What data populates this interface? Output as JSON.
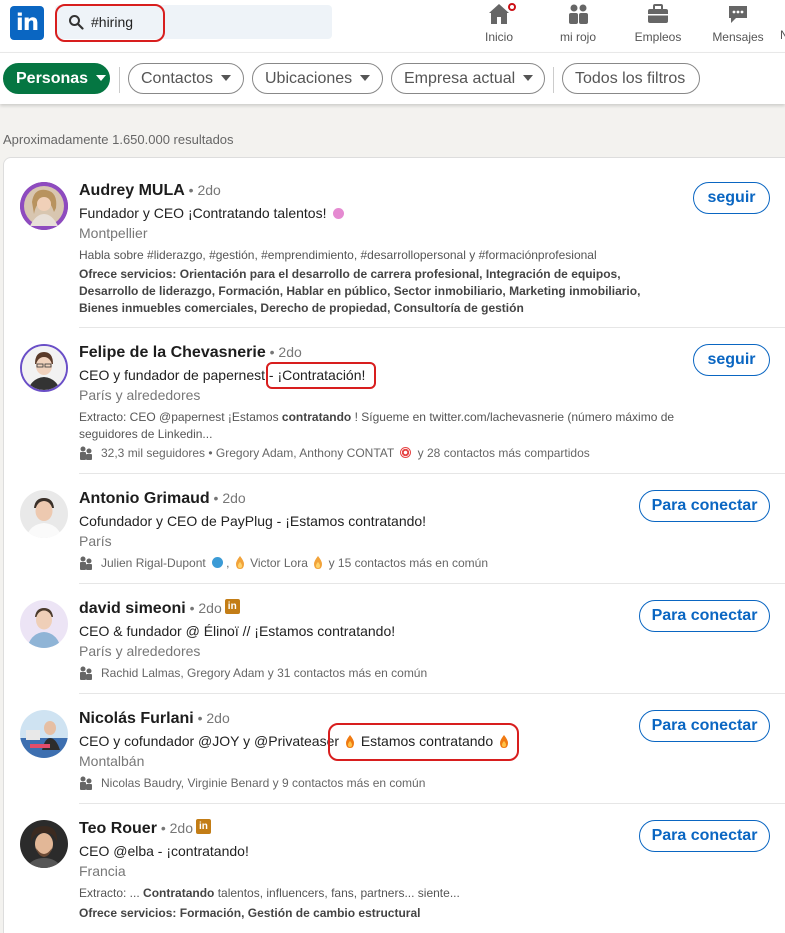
{
  "nav": {
    "logo_text": "in",
    "search_value": "#hiring",
    "items": [
      {
        "label": "Inicio",
        "icon": "home-icon"
      },
      {
        "label": "mi rojo",
        "icon": "network-icon"
      },
      {
        "label": "Empleos",
        "icon": "briefcase-icon"
      },
      {
        "label": "Mensajes",
        "icon": "messaging-icon"
      }
    ],
    "overflow_label": "N"
  },
  "filters": {
    "personas": "Personas",
    "contactos": "Contactos",
    "ubicaciones": "Ubicaciones",
    "empresa_actual": "Empresa actual",
    "todos": "Todos los filtros"
  },
  "results_count": "Aproximadamente 1.650.000 resultados",
  "colors": {
    "brand": "#0a66c2",
    "active_filter": "#057642",
    "annotation": "#d81e1e",
    "badge": "#c37d16"
  },
  "results": [
    {
      "name": "Audrey MULA",
      "degree": " • 2do",
      "headline": "Fundador y CEO ¡Contratando talentos!",
      "location": "Montpellier",
      "topics": "Habla sobre #liderazgo, #gestión, #emprendimiento, #desarrollopersonal y #formaciónprofesional",
      "services_label": "Ofrece servicios: ",
      "services": "Orientación para el desarrollo de carrera profesional, Integración de equipos, Desarrollo de liderazgo, Formación, Hablar en público, Sector inmobiliario, Marketing inmobiliario, Bienes inmuebles comerciales, Derecho de propiedad, Consultoría de gestión",
      "button": "seguir"
    },
    {
      "name": "Felipe de la Chevasnerie",
      "degree": " • 2do",
      "headline_a": "CEO y fundador de papernest ",
      "headline_b": "- ¡Contratación!",
      "location": "París y alrededores",
      "extract_a": "Extracto: CEO @papernest ¡Estamos ",
      "extract_bold": "contratando",
      "extract_b": " ! Sígueme en twitter.com/lachevasnerie (número máximo de seguidores de Linkedin...",
      "meta": "32,3 mil seguidores • Gregory Adam, Anthony CONTAT",
      "meta_tail": " y 28 contactos más compartidos",
      "button": "seguir"
    },
    {
      "name": "Antonio Grimaud",
      "degree": " • 2do",
      "headline": "Cofundador y CEO de PayPlug - ¡Estamos contratando!",
      "location": "París",
      "meta_a": "Julien Rigal-Dupont",
      "meta_b": " Victor Lora",
      "meta_c": " y 15 contactos más en común",
      "button": "Para conectar"
    },
    {
      "name": "david simeoni",
      "degree": " • 2do",
      "badge": "in",
      "headline": "CEO & fundador @ Élinoï // ¡Estamos contratando!",
      "location": "París y alrededores",
      "meta": "Rachid Lalmas, Gregory Adam y 31 contactos más en común",
      "button": "Para conectar"
    },
    {
      "name": "Nicolás Furlani",
      "degree": " • 2do",
      "headline_a": "CEO y cofundador @JOY y @Privateaser",
      "headline_b": " Estamos contratando ",
      "location": "Montalbán",
      "meta": "Nicolas Baudry, Virginie Benard y 9 contactos más en común",
      "button": "Para conectar"
    },
    {
      "name": "Teo Rouer",
      "degree": " • 2do",
      "badge": "in",
      "headline": "CEO @elba - ¡contratando!",
      "location": "Francia",
      "extract_a": "Extracto: ... ",
      "extract_bold": "Contratando",
      "extract_b": " talentos, influencers, fans, partners... siente...",
      "services_label": "Ofrece servicios: ",
      "services": "Formación, Gestión de cambio estructural",
      "button": "Para conectar"
    }
  ]
}
